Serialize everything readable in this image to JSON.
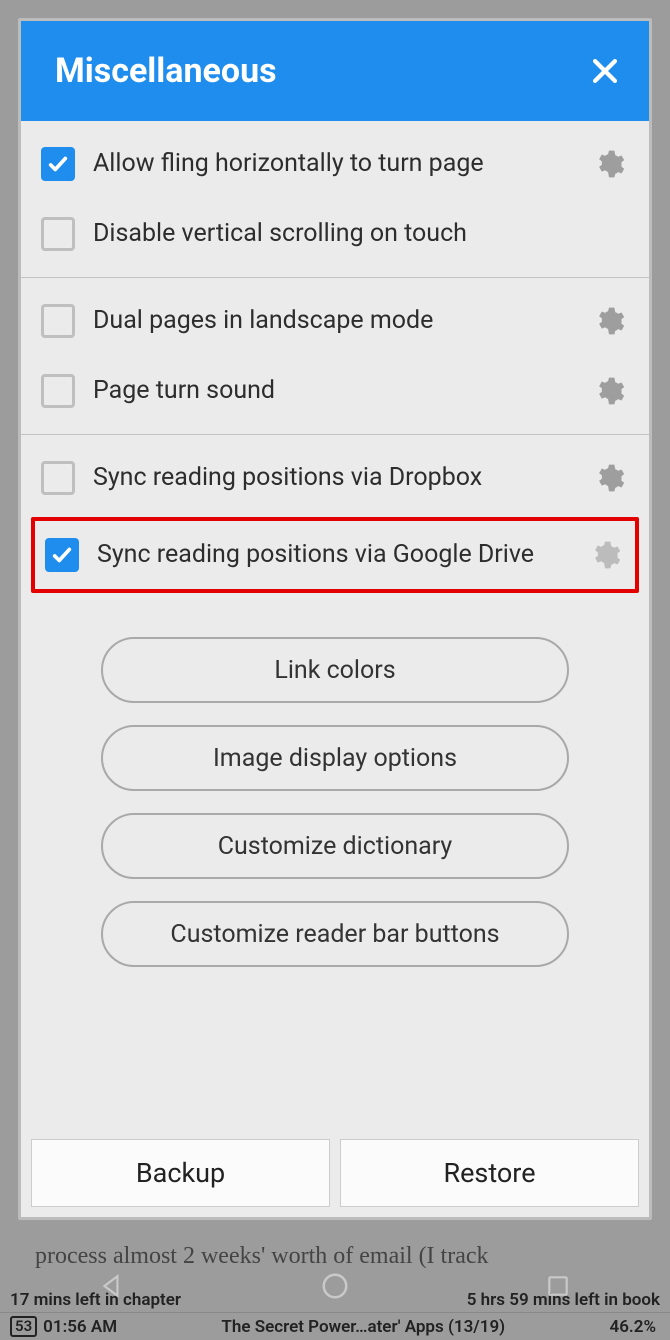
{
  "dialog": {
    "title": "Miscellaneous"
  },
  "sections": [
    {
      "items": [
        {
          "label": "Allow fling horizontally to turn page",
          "checked": true,
          "gear": true,
          "highlighted": false
        },
        {
          "label": "Disable vertical scrolling on touch",
          "checked": false,
          "gear": false,
          "highlighted": false
        }
      ]
    },
    {
      "items": [
        {
          "label": "Dual pages in landscape mode",
          "checked": false,
          "gear": true,
          "highlighted": false
        },
        {
          "label": "Page turn sound",
          "checked": false,
          "gear": true,
          "highlighted": false
        }
      ]
    },
    {
      "items": [
        {
          "label": "Sync reading positions via Dropbox",
          "checked": false,
          "gear": true,
          "highlighted": false
        },
        {
          "label": "Sync reading positions via Google Drive",
          "checked": true,
          "gear": true,
          "highlighted": true
        }
      ]
    }
  ],
  "pill_buttons": [
    "Link colors",
    "Image display options",
    "Customize dictionary",
    "Customize reader bar buttons"
  ],
  "footer": {
    "backup": "Backup",
    "restore": "Restore"
  },
  "background": {
    "partial_text": "process almost 2 weeks' worth of email (I track",
    "mins_left_chapter": "17 mins left in chapter",
    "hrs_left_book": "5 hrs 59 mins left in book",
    "battery": "53",
    "time": "01:56 AM",
    "book_title": "The Secret Power…ater' Apps (13/19)",
    "progress": "46.2%"
  }
}
